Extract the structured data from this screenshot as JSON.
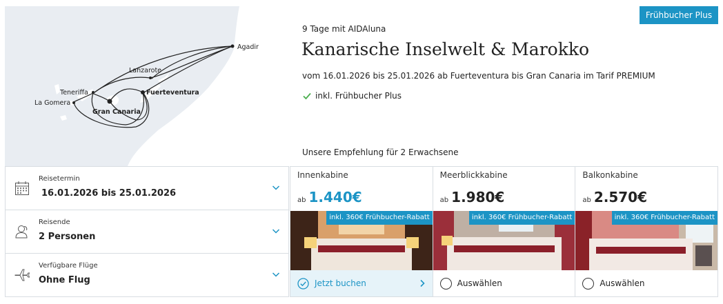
{
  "badge": "Frühbucher Plus",
  "cruise": {
    "subtitle": "9 Tage mit AIDAluna",
    "title": "Kanarische Inselwelt & Marokko",
    "dates": "vom 16.01.2026 bis 25.01.2026 ab Fuerteventura bis Gran Canaria im Tarif PREMIUM",
    "included": "inkl. Frühbucher Plus",
    "recommendation": "Unsere Empfehlung für 2 Erwachsene"
  },
  "map": {
    "ports": [
      "Agadir",
      "Lanzarote",
      "Teneriffa",
      "Fuerteventura",
      "La Gomera",
      "Gran Canaria"
    ]
  },
  "selectors": [
    {
      "label": "Reisetermin",
      "value": "16.01.2026 bis 25.01.2026",
      "icon": "calendar-icon"
    },
    {
      "label": "Reisende",
      "value": "2 Personen",
      "icon": "person-icon"
    },
    {
      "label": "Verfügbare Flüge",
      "value": "Ohne Flug",
      "icon": "plane-icon"
    }
  ],
  "cabins": [
    {
      "name": "Innenkabine",
      "prefix": "ab",
      "price": "1.440€",
      "discount": "inkl. 360€ Frühbucher-Rabatt",
      "action": "Jetzt buchen",
      "selected": true
    },
    {
      "name": "Meerblickkabine",
      "prefix": "ab",
      "price": "1.980€",
      "discount": "inkl. 360€ Frühbucher-Rabatt",
      "action": "Auswählen",
      "selected": false
    },
    {
      "name": "Balkonkabine",
      "prefix": "ab",
      "price": "2.570€",
      "discount": "inkl. 360€ Frühbucher-Rabatt",
      "action": "Auswählen",
      "selected": false
    }
  ],
  "colors": {
    "accent": "#1c94c5",
    "selected_bg": "#e6f3f9",
    "border": "#d8dde2",
    "map_sea": "#e9edf2",
    "map_land": "#ffffff"
  }
}
